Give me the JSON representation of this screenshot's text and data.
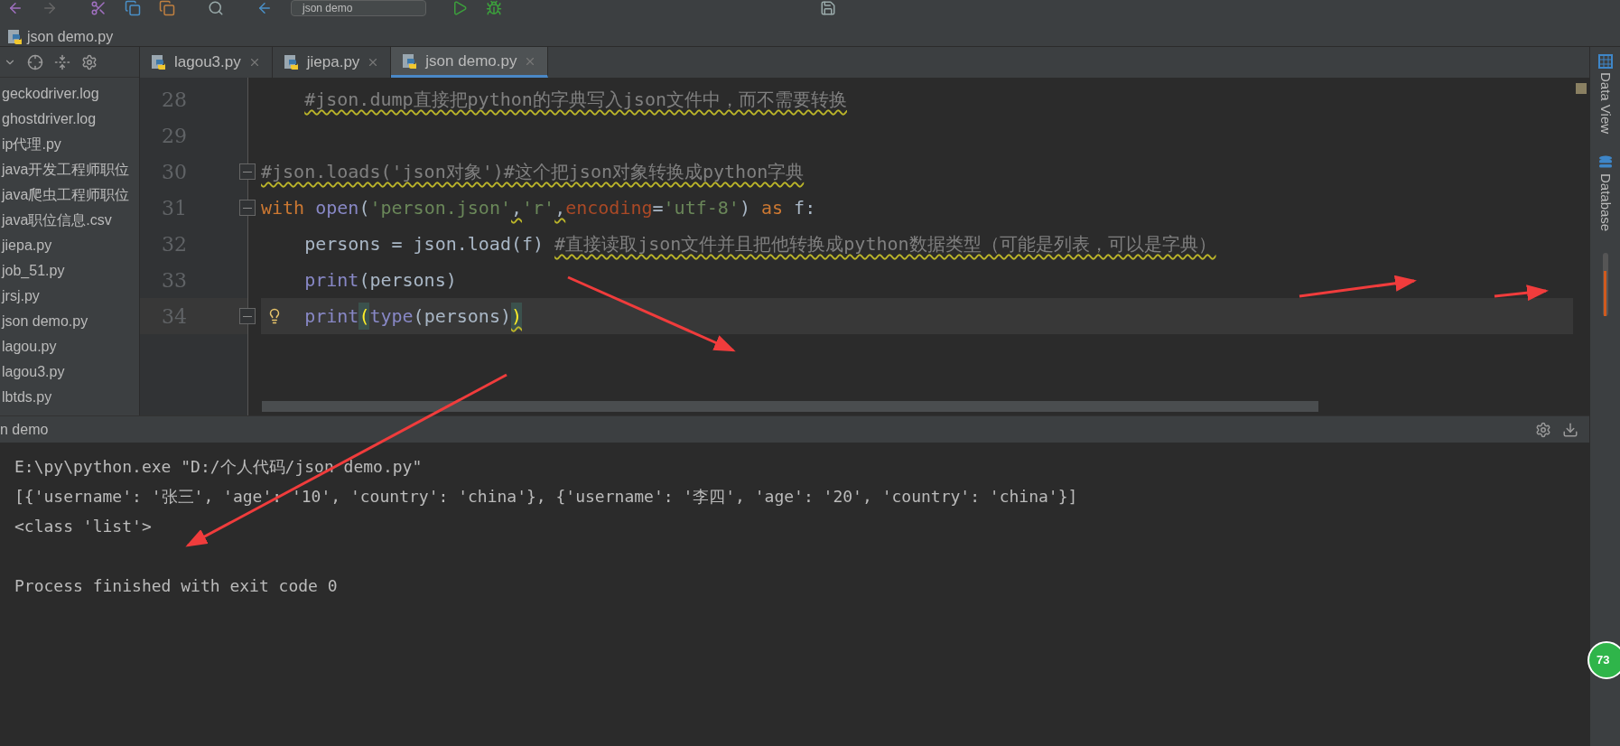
{
  "toolbar": {
    "run_config": "json demo"
  },
  "breadcrumb": "json demo.py",
  "project_files": [
    {
      "name": "geckodriver.log"
    },
    {
      "name": "ghostdriver.log"
    },
    {
      "name": "ip代理.py"
    },
    {
      "name": "java开发工程师职位"
    },
    {
      "name": "java爬虫工程师职位"
    },
    {
      "name": "java职位信息.csv"
    },
    {
      "name": "jiepa.py"
    },
    {
      "name": "job_51.py"
    },
    {
      "name": "jrsj.py"
    },
    {
      "name": "json demo.py"
    },
    {
      "name": "lagou.py"
    },
    {
      "name": "lagou3.py"
    },
    {
      "name": "lbtds.py"
    }
  ],
  "tabs": [
    {
      "label": "lagou3.py",
      "selected": false
    },
    {
      "label": "jiepa.py",
      "selected": false
    },
    {
      "label": "json demo.py",
      "selected": true
    }
  ],
  "editor_lines": [
    {
      "number": "28",
      "fold": false,
      "current": false,
      "bulb": false,
      "indented": true,
      "tokens": [
        {
          "text": "#json.dump直接把python的字典写入json文件中，而不需要转换",
          "kind": "comment",
          "warn": true
        }
      ]
    },
    {
      "number": "29",
      "fold": false,
      "current": false,
      "bulb": false,
      "indented": false
    },
    {
      "number": "30",
      "fold": true,
      "current": false,
      "bulb": false,
      "indented": false,
      "tokens": [
        {
          "text": "#json.loads('json对象')#这个把json对象转换成python字典",
          "kind": "comment",
          "warn": true
        }
      ]
    },
    {
      "number": "31",
      "fold": true,
      "current": false,
      "bulb": false,
      "indented": false,
      "tokens": [
        {
          "text": "with ",
          "kind": "keyword",
          "warn": false
        },
        {
          "text": "open",
          "kind": "builtin",
          "warn": false
        },
        {
          "text": "(",
          "kind": "plain",
          "warn": false
        },
        {
          "text": "'person.json'",
          "kind": "string",
          "warn": false
        },
        {
          "text": ",",
          "kind": "plain",
          "warn": true
        },
        {
          "text": "'r'",
          "kind": "string",
          "warn": false
        },
        {
          "text": ",",
          "kind": "plain",
          "warn": true
        },
        {
          "text": "encoding",
          "kind": "param",
          "warn": false
        },
        {
          "text": "=",
          "kind": "plain",
          "warn": false
        },
        {
          "text": "'utf-8'",
          "kind": "string",
          "warn": false
        },
        {
          "text": ") ",
          "kind": "plain",
          "warn": false
        },
        {
          "text": "as",
          "kind": "keyword",
          "warn": false
        },
        {
          "text": " f:",
          "kind": "plain",
          "warn": false
        }
      ]
    },
    {
      "number": "32",
      "fold": false,
      "current": false,
      "bulb": false,
      "indented": true,
      "tokens": [
        {
          "text": "persons = json.load(f) ",
          "kind": "plain",
          "warn": false
        },
        {
          "text": "#直接读取json文件并且把他转换成python数据类型（可能是列表，可以是字典）",
          "kind": "comment",
          "warn": true
        }
      ]
    },
    {
      "number": "33",
      "fold": false,
      "current": false,
      "bulb": false,
      "indented": true,
      "tokens": [
        {
          "text": "print",
          "kind": "builtin",
          "warn": false
        },
        {
          "text": "(persons)",
          "kind": "plain",
          "warn": false
        }
      ]
    },
    {
      "number": "34",
      "fold": true,
      "current": true,
      "bulb": true,
      "indented": true,
      "tokens": [
        {
          "text": "print",
          "kind": "builtin",
          "warn": false
        },
        {
          "text": "(",
          "kind": "match",
          "warn": false
        },
        {
          "text": "type",
          "kind": "builtin",
          "warn": false
        },
        {
          "text": "(persons)",
          "kind": "plain",
          "warn": false
        },
        {
          "text": ")",
          "kind": "match",
          "warn": true
        }
      ]
    }
  ],
  "run_panel": {
    "title": "n demo",
    "console": [
      {
        "kind": "line",
        "text": "E:\\py\\python.exe \"D:/个人代码/json demo.py\""
      },
      {
        "kind": "line",
        "text": "[{'username': '张三', 'age': '10', 'country': 'china'}, {'username': '李四', 'age': '20', 'country': 'china'}]"
      },
      {
        "kind": "line",
        "text": "<class 'list'>"
      },
      {
        "kind": "blank"
      },
      {
        "kind": "line",
        "text": "Process finished with exit code 0"
      }
    ]
  },
  "right_tool_strip": [
    {
      "label": "Data View",
      "kind": "grid"
    },
    {
      "label": "Database",
      "kind": "db"
    }
  ],
  "badge": "73"
}
